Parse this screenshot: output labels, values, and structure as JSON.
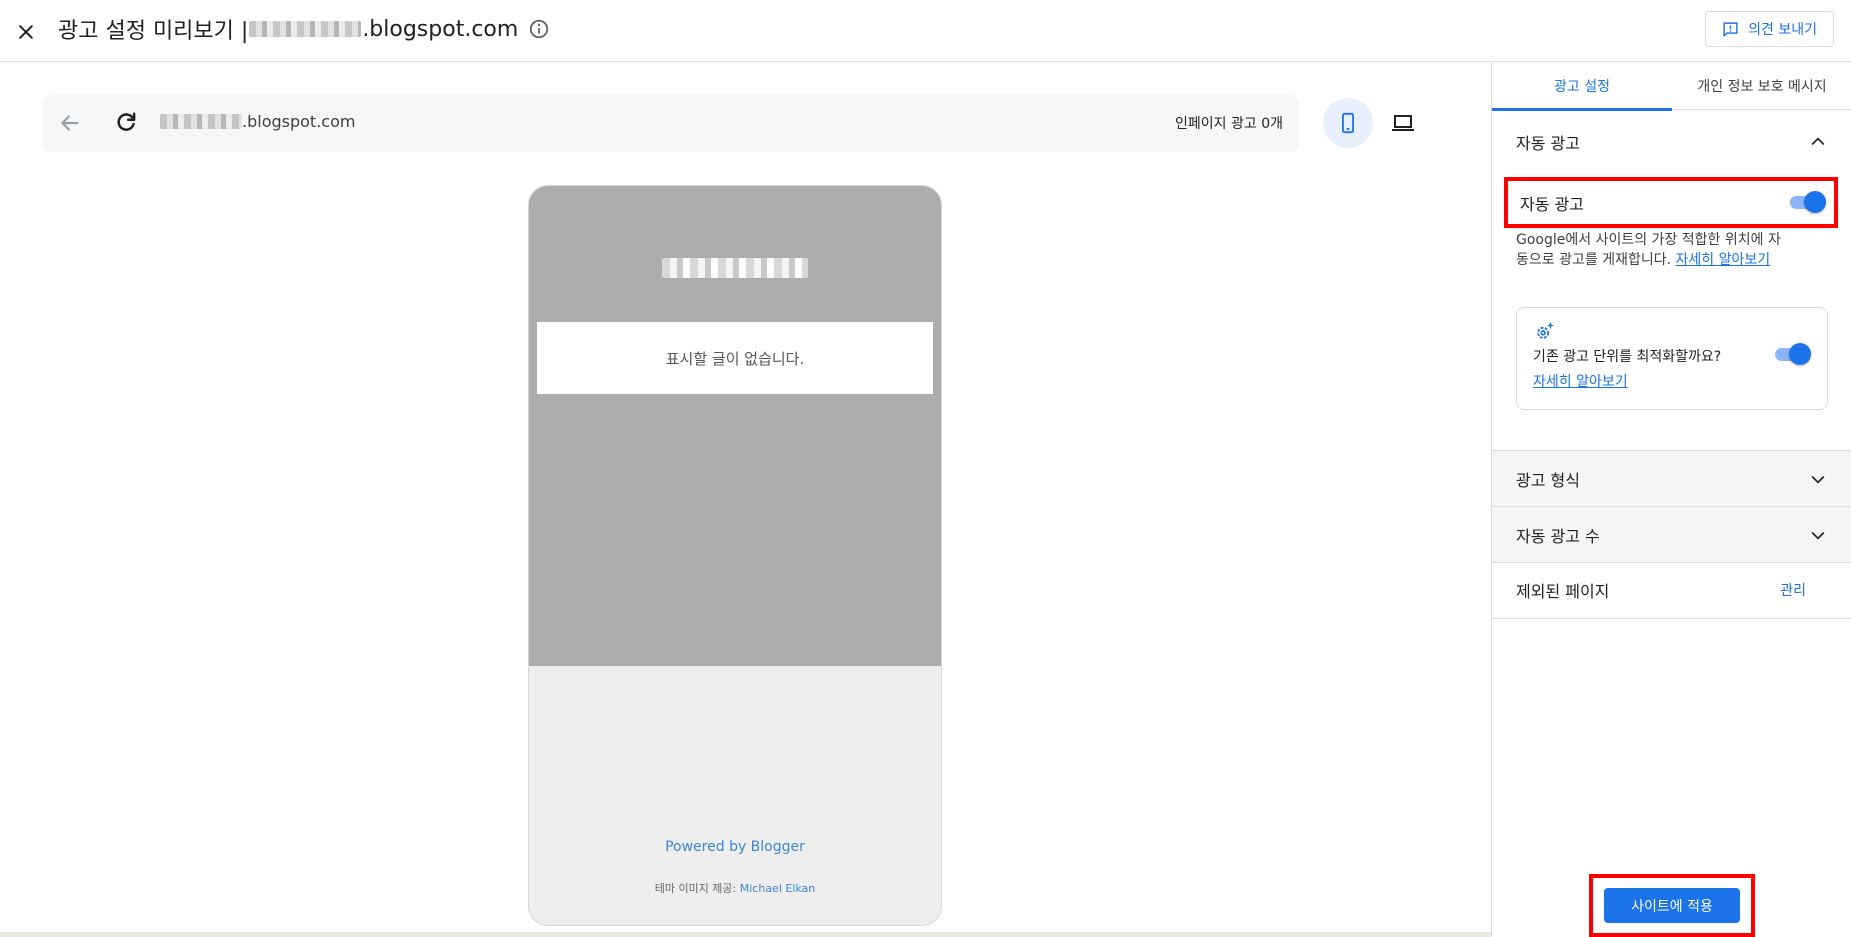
{
  "header": {
    "title_prefix": "광고 설정 미리보기 |",
    "title_domain": ".blogspot.com",
    "feedback_label": "의견 보내기"
  },
  "address_bar": {
    "url_domain": ".blogspot.com",
    "inpage_ads": "인페이지 광고 0개"
  },
  "preview": {
    "empty_message": "표시할 글이 없습니다.",
    "powered_by": "Powered by Blogger",
    "credit_prefix": "테마 이미지 제공:",
    "credit_name": "Michael Elkan"
  },
  "panel": {
    "tabs": [
      "광고 설정",
      "개인 정보 보호 메시지"
    ],
    "auto_ads_section": "자동 광고",
    "auto_ads_toggle_label": "자동 광고",
    "auto_ads_enabled": true,
    "auto_ads_desc": "Google에서 사이트의 가장 적합한 위치에 자동으로 광고를 게재합니다.",
    "learn_more": "자세히 알아보기",
    "optimize_label": "기존 광고 단위를 최적화할까요?",
    "optimize_enabled": true,
    "optimize_link": "자세히 알아보기",
    "ad_formats": "광고 형식",
    "ad_load": "자동 광고 수",
    "excluded_pages": "제외된 페이지",
    "manage": "관리",
    "apply_button": "사이트에 적용"
  },
  "colors": {
    "accent": "#1a73e8",
    "highlight_border": "#ff0000",
    "toggle_track": "#8ab4f8"
  },
  "icons": [
    "close-icon",
    "info-icon",
    "feedback-icon",
    "back-arrow-icon",
    "reload-icon",
    "mobile-device-icon",
    "desktop-device-icon",
    "chevron-up-icon",
    "chevron-down-icon",
    "sparkle-gear-icon"
  ]
}
